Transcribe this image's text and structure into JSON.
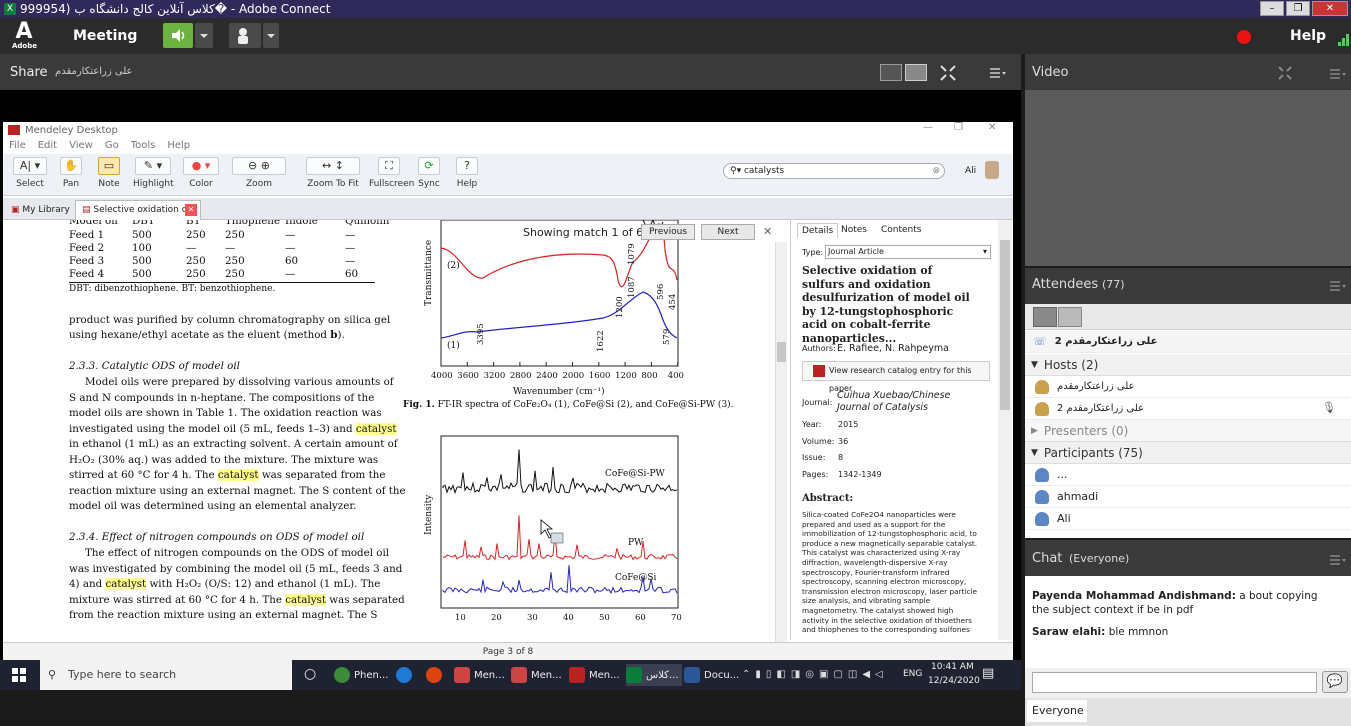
{
  "window": {
    "title": "999954) كلاس آنلاین كالج دانشگاه ب� - Adobe Connect",
    "icon": "excel-icon"
  },
  "connect": {
    "logo": "A",
    "logo_sub": "Adobe",
    "meeting": "Meeting",
    "help": "Help"
  },
  "share": {
    "label": "Share",
    "presenter": "علی زراعتکارمقدم"
  },
  "mendeley": {
    "title": "Mendeley Desktop",
    "menu": [
      "File",
      "Edit",
      "View",
      "Go",
      "Tools",
      "Help"
    ],
    "tools": [
      {
        "label": "Select",
        "icon": "cursor-text-icon"
      },
      {
        "label": "Pan",
        "icon": "hand-icon"
      },
      {
        "label": "Note",
        "icon": "note-icon"
      },
      {
        "label": "Highlight",
        "icon": "highlight-icon"
      },
      {
        "label": "Color",
        "icon": "color-icon"
      },
      {
        "label": "Zoom",
        "icon": "zoom-icon"
      },
      {
        "label": "Zoom To Fit",
        "icon": "zoom-fit-icon"
      },
      {
        "label": "Fullscreen",
        "icon": "fullscreen-icon"
      },
      {
        "label": "Sync",
        "icon": "sync-icon"
      },
      {
        "label": "Help",
        "icon": "help-icon"
      }
    ],
    "search": "catalysts",
    "user": "Ali",
    "tabs": [
      "My Library",
      "Selective oxidation of ..."
    ],
    "match": {
      "text": "Showing match 1 of 61",
      "previous": "Previous",
      "next": "Next"
    },
    "page": "Page 3 of 8"
  },
  "doc": {
    "table": {
      "header": [
        "Model oil",
        "DBT",
        "BT",
        "Thiophene",
        "Indole",
        "Quinolin"
      ],
      "rows": [
        [
          "Feed 1",
          "500",
          "250",
          "250",
          "—",
          "—"
        ],
        [
          "Feed 2",
          "100",
          "—",
          "—",
          "—",
          "—"
        ],
        [
          "Feed 3",
          "500",
          "250",
          "250",
          "60",
          "—"
        ],
        [
          "Feed 4",
          "500",
          "250",
          "250",
          "—",
          "60"
        ]
      ],
      "note": "DBT: dibenzothiophene. BT: benzothiophene."
    },
    "p1": [
      "product was purified by column chromatography on silica gel",
      "using hexane/ethyl acetate as the eluent (method b)."
    ],
    "h1": "2.3.3.   Catalytic ODS of model oil",
    "p2": [
      "Model oils were prepared by dissolving various amounts of",
      "S and N compounds in n-heptane. The compositions of the",
      "model oils are shown in Table 1. The oxidation reaction was",
      "investigated using the model oil (5 mL, feeds 1–3) and ",
      "in ethanol (1 mL) as an extracting solvent. A certain amount of",
      "H₂O₂ (30% aq.) was added to the mixture. The mixture was",
      "stirred at 60 °C for 4 h. The ",
      " was separated from the",
      "reaction mixture using an external magnet. The S content of the",
      "model oil was determined using an elemental analyzer."
    ],
    "hlword": "catalyst",
    "h2": "2.3.4.   Effect of nitrogen compounds on ODS of model oil",
    "p3": [
      "The effect of nitrogen compounds on the ODS of model oil",
      "was investigated by combining the model oil (5 mL, feeds 3 and",
      "4) and ",
      " with H₂O₂ (O/S: 12) and ethanol (1 mL). The",
      "mixture was stirred at 60 °C for 4 h. The ",
      " was separated",
      "from the reaction mixture using an external magnet. The S"
    ],
    "fig1": {
      "caption_b": "Fig. 1.",
      "caption": " FT-IR spectra of CoFe₂O₄ (1), CoFe@Si (2), and CoFe@Si-PW (3).",
      "xlabel": "Wavenumber (cm⁻¹)",
      "ylabel": "Transmittance",
      "ticks": [
        "4000",
        "3600",
        "3200",
        "2800",
        "2400",
        "2000",
        "1600",
        "1200",
        "800",
        "400"
      ],
      "peaks": [
        "1079",
        "1087",
        "1200",
        "596",
        "454",
        "3395",
        "1622",
        "579"
      ],
      "series": [
        "(2)",
        "(1)"
      ]
    },
    "fig2": {
      "ylabel": "Intensity",
      "ticks": [
        "10",
        "20",
        "30",
        "40",
        "50",
        "60",
        "70"
      ],
      "series": [
        "CoFe@Si-PW",
        "PW",
        "CoFe@Si"
      ]
    }
  },
  "details": {
    "tabs": [
      "Details",
      "Notes",
      "Contents"
    ],
    "type_label": "Type:",
    "type": "Journal Article",
    "title": "Selective oxidation of sulfurs and oxidation desulfurization of model oil by 12-tungstophosphoric acid on cobalt-ferrite nanoparticles...",
    "authors_label": "Authors:",
    "authors": "E. Rafiee, N. Rahpeyma",
    "catalog": "View research catalog entry for this paper",
    "journal_label": "Journal:",
    "journal": "Cuihua Xuebao/Chinese Journal of Catalysis",
    "fields": [
      {
        "label": "Year:",
        "value": "2015"
      },
      {
        "label": "Volume:",
        "value": "36"
      },
      {
        "label": "Issue:",
        "value": "8"
      },
      {
        "label": "Pages:",
        "value": "1342-1349"
      }
    ],
    "abstract_label": "Abstract:",
    "abstract": [
      "Silica-coated CoFe2O4 nanoparticles were",
      "prepared and used as a support for the",
      "immobilization of 12-tungstophosphoric acid, to",
      "produce a new magnetically separable catalyst.",
      "This catalyst was characterized using X-ray",
      "diffraction, wavelength-dispersive X-ray",
      "spectroscopy, Fourier-transform infrared",
      "spectroscopy, scanning electron microscopy,",
      "transmission electron microscopy, laser particle",
      "size analysis, and vibrating sample",
      "magnetometry. The catalyst showed high",
      "activity in the selective oxidation of thioethers",
      "and thiophenes to the corresponding sulfones"
    ]
  },
  "taskbar": {
    "search": "Type here to search",
    "apps": [
      "Phen...",
      "",
      "",
      "Men...",
      "Men...",
      "Men...",
      "كلاس...",
      "Docu..."
    ],
    "lang": "ENG",
    "time": "10:41 AM",
    "date": "12/24/2020"
  },
  "video": {
    "label": "Video"
  },
  "attendees": {
    "label": "Attendees",
    "count": "(77)",
    "me": "علی زراعتکارمقدم 2",
    "hosts_label": "Hosts (2)",
    "hosts": [
      "علی زراعتکارمقدم",
      "علی زراعتکارمقدم 2"
    ],
    "presenters_label": "Presenters (0)",
    "participants_label": "Participants (75)",
    "participants": [
      "...",
      "ahmadi",
      "Ali"
    ]
  },
  "chat": {
    "label": "Chat",
    "scope": "(Everyone)",
    "messages": [
      {
        "name": "Payenda Mohammad Andishmand:",
        "text": " a bout copying the subject context if be in pdf"
      },
      {
        "name": "Saraw elahi:",
        "text": " ble mmnon"
      }
    ],
    "recipient": "Everyone"
  }
}
